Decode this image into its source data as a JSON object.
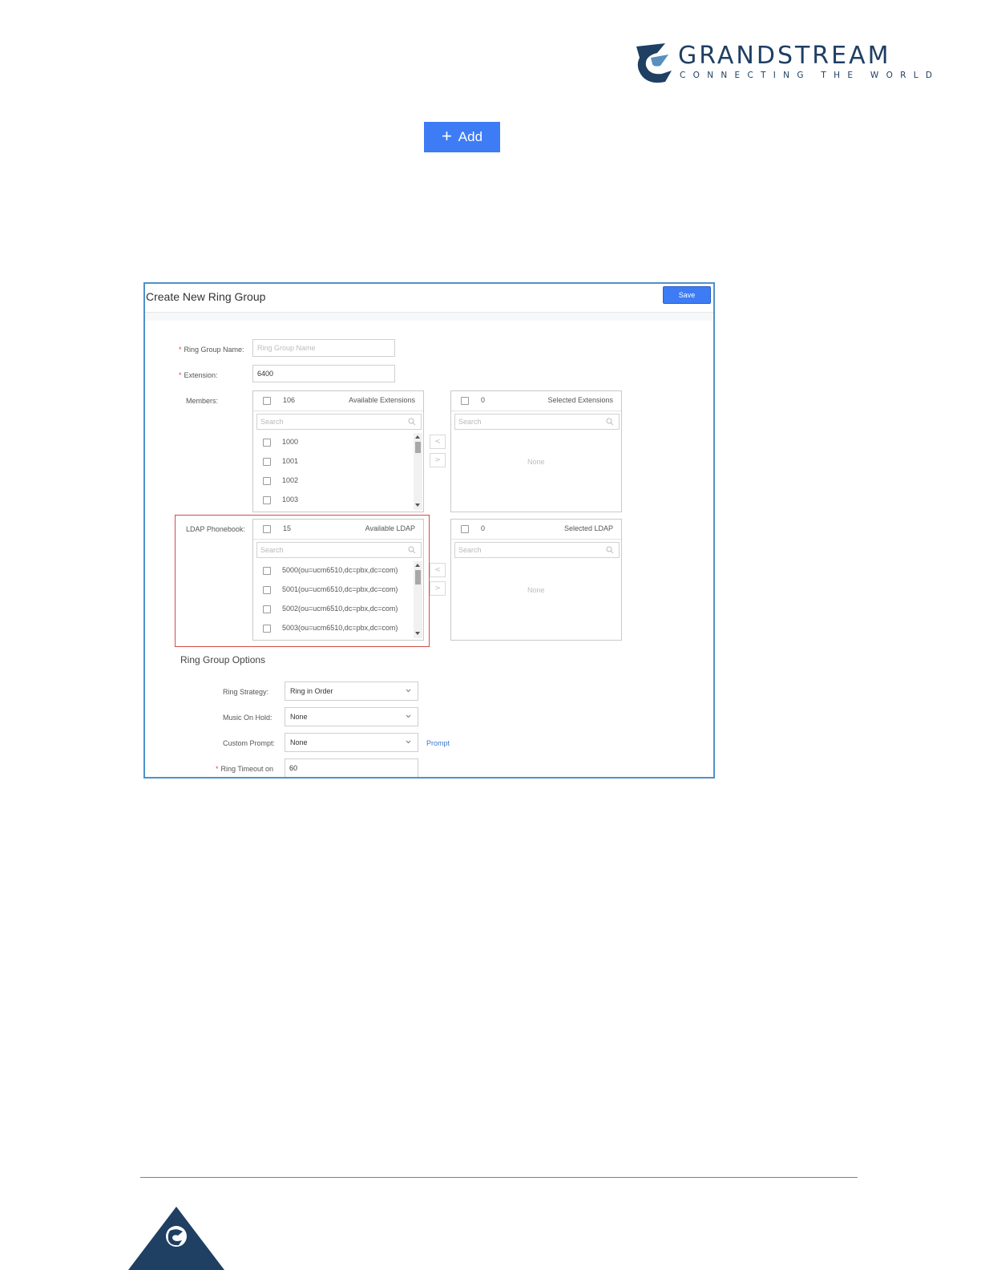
{
  "brand": {
    "name": "GRANDSTREAM",
    "tagline": "CONNECTING THE WORLD",
    "primary_color": "#1f3f63",
    "accent_color": "#3d7cf5"
  },
  "add_button": {
    "icon": "plus-icon",
    "label": "Add"
  },
  "dialog": {
    "title": "Create New Ring Group",
    "save_label": "Save",
    "fields": {
      "ring_group_name": {
        "label": "Ring Group Name:",
        "placeholder": "Ring Group Name",
        "value": ""
      },
      "extension": {
        "label": "Extension:",
        "value": "6400"
      },
      "members_label": "Members:",
      "ldap_label": "LDAP Phonebook:"
    },
    "members": {
      "available": {
        "count": "106",
        "title": "Available Extensions",
        "search_placeholder": "Search",
        "items": [
          "1000",
          "1001",
          "1002",
          "1003"
        ]
      },
      "selected": {
        "count": "0",
        "title": "Selected Extensions",
        "search_placeholder": "Search",
        "empty_text": "None"
      }
    },
    "ldap": {
      "available": {
        "count": "15",
        "title": "Available LDAP",
        "search_placeholder": "Search",
        "items": [
          "5000(ou=ucm6510,dc=pbx,dc=com)",
          "5001(ou=ucm6510,dc=pbx,dc=com)",
          "5002(ou=ucm6510,dc=pbx,dc=com)",
          "5003(ou=ucm6510,dc=pbx,dc=com)"
        ]
      },
      "selected": {
        "count": "0",
        "title": "Selected LDAP",
        "search_placeholder": "Search",
        "empty_text": "None"
      }
    },
    "move_left_glyph": "<",
    "move_right_glyph": ">",
    "options": {
      "section_title": "Ring Group Options",
      "ring_strategy": {
        "label": "Ring Strategy:",
        "value": "Ring in Order"
      },
      "music_on_hold": {
        "label": "Music On Hold:",
        "value": "None"
      },
      "custom_prompt": {
        "label": "Custom Prompt:",
        "value": "None",
        "link": "Prompt"
      },
      "ring_timeout": {
        "label": "Ring Timeout on",
        "value": "60"
      }
    }
  }
}
